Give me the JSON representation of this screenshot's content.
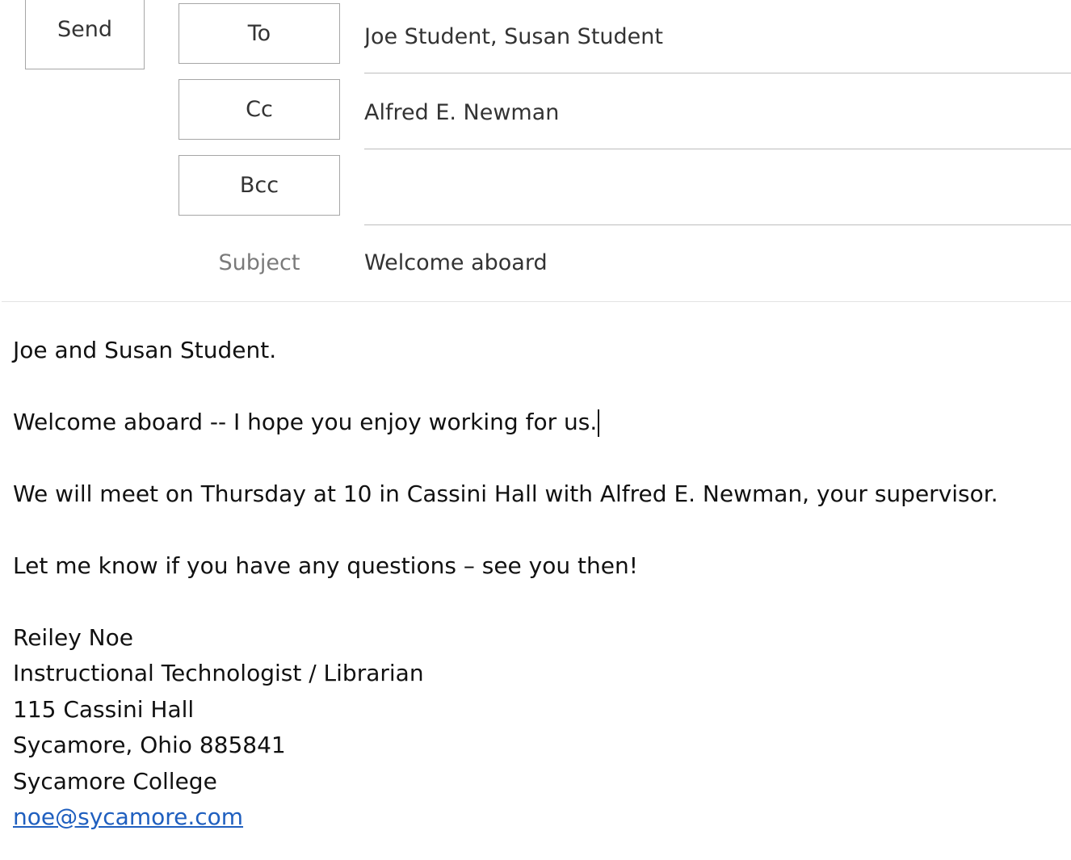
{
  "compose": {
    "send_label": "Send",
    "to_label": "To",
    "cc_label": "Cc",
    "bcc_label": "Bcc",
    "subject_label": "Subject",
    "to_value": "Joe Student, Susan Student",
    "cc_value": "Alfred E. Newman",
    "bcc_value": "",
    "subject_value": "Welcome aboard"
  },
  "body": {
    "greeting": "Joe and Susan Student.",
    "line1": "Welcome aboard -- I hope you enjoy working for us.",
    "line2": "We will meet on Thursday at 10 in Cassini Hall with Alfred E. Newman, your supervisor.",
    "line3": "Let me know if you have any questions – see you then!"
  },
  "signature": {
    "name": "Reiley Noe",
    "title": "Instructional Technologist / Librarian",
    "address1": "115 Cassini Hall",
    "address2": "Sycamore, Ohio 885841",
    "organization": "Sycamore College",
    "email": "noe@sycamore.com"
  },
  "colors": {
    "link": "#1f5fbf",
    "border": "#a6a6a6",
    "label_muted": "#7a7a7a"
  }
}
